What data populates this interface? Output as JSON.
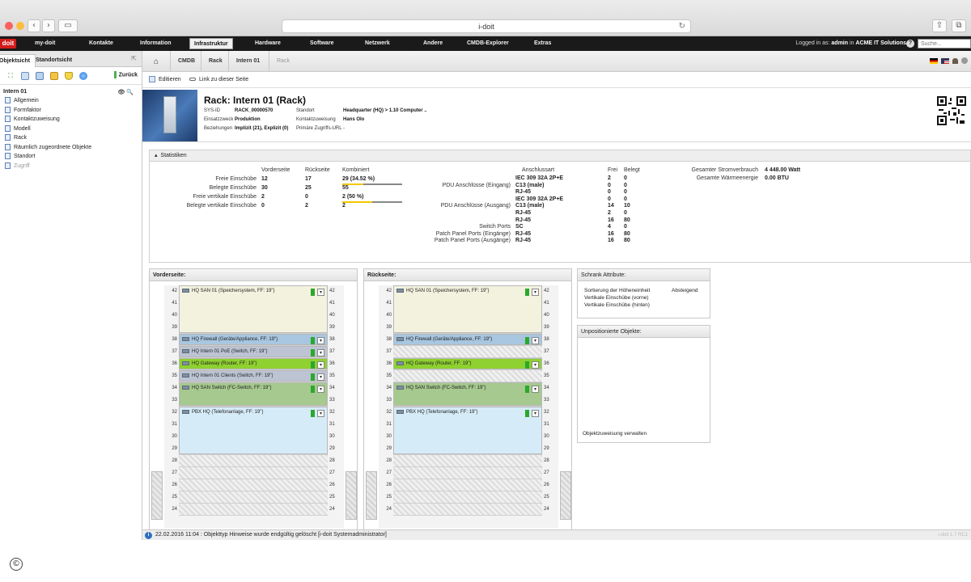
{
  "browser": {
    "url_title": "i-doit",
    "back_glyph": "‹",
    "forward_glyph": "›",
    "sidebar_glyph": "▭",
    "reload_glyph": "↻",
    "share_glyph": "⇧",
    "tabs_glyph": "⧉",
    "traffic": [
      "#fc605c",
      "#fdbc40",
      "#34c84a"
    ]
  },
  "topnav": {
    "logo": "doit",
    "items": [
      "my-doit",
      "Kontakte",
      "Information",
      "Infrastruktur",
      "Hardware",
      "Software",
      "Netzwerk",
      "Andere",
      "CMDB-Explorer",
      "Extras"
    ],
    "active_index": 3,
    "logged_in_prefix": "Logged in as:",
    "user": "admin",
    "in": "in",
    "company": "ACME IT Solutions",
    "help": "?",
    "search_placeholder": "Suche..."
  },
  "leftpanel": {
    "tab_object": "Objektsicht",
    "tab_location": "Standortsicht",
    "collapse": "⇱",
    "back_label": "Zurück",
    "root": "Intern 01",
    "root_icons": "👁 🔍",
    "items": [
      {
        "label": "Allgemein",
        "dim": false
      },
      {
        "label": "Formfaktor",
        "dim": false
      },
      {
        "label": "Kontaktzuweisung",
        "dim": false
      },
      {
        "label": "Modell",
        "dim": false
      },
      {
        "label": "Rack",
        "dim": false
      },
      {
        "label": "Räumlich zugeordnete Objekte",
        "dim": false
      },
      {
        "label": "Standort",
        "dim": false
      },
      {
        "label": "Zugriff",
        "dim": true
      }
    ]
  },
  "breadcrumb": {
    "home": "⌂",
    "items": [
      "CMDB",
      "Rack",
      "Intern 01",
      "Rack"
    ]
  },
  "actions": {
    "edit": "Editieren",
    "link": "Link zu dieser Seite"
  },
  "object": {
    "title": "Rack: Intern 01 (Rack)",
    "sysid_label": "SYS-ID",
    "sysid": "RACK_00000570",
    "purpose_label": "Einsatzzweck",
    "purpose": "Produktion",
    "relations_label": "Beziehungen",
    "relations": "Implizit (21), Explizit (0)",
    "location_label": "Standort",
    "location": "Headquarter (HQ) > 1.10 Computer ..",
    "contact_label": "Kontaktzuweisung",
    "contact": "Hans Olo",
    "url_label": "Primäre Zugriffs-URL",
    "url": "-"
  },
  "stats": {
    "header": "Statistiken",
    "col_front": "Vorderseite",
    "col_back": "Rückseite",
    "col_combined": "Kombiniert",
    "rows": [
      {
        "label": "Freie Einschübe",
        "front": "12",
        "back": "17",
        "combined": "29 (34.52 %)",
        "bar": 0.3452
      },
      {
        "label": "Belegte Einschübe",
        "front": "30",
        "back": "25",
        "combined": "55"
      },
      {
        "label": "Freie vertikale Einschübe",
        "front": "2",
        "back": "0",
        "combined": "2 (50 %)",
        "bar": 0.5
      },
      {
        "label": "Belegte vertikale Einschübe",
        "front": "0",
        "back": "2",
        "combined": "2"
      }
    ],
    "conn_header": "Anschlussart",
    "free_header": "Frei",
    "used_header": "Belegt",
    "ports": [
      {
        "label": "",
        "type": "IEC 309 32A 2P+E",
        "free": "2",
        "used": "0"
      },
      {
        "label": "PDU Anschlüsse (Eingang)",
        "type": "C13 (male)",
        "free": "0",
        "used": "0"
      },
      {
        "label": "",
        "type": "RJ-45",
        "free": "0",
        "used": "0"
      },
      {
        "label": "",
        "type": "IEC 309 32A 2P+E",
        "free": "0",
        "used": "0"
      },
      {
        "label": "PDU Anschlüsse (Ausgang)",
        "type": "C13 (male)",
        "free": "14",
        "used": "10"
      },
      {
        "label": "",
        "type": "RJ-45",
        "free": "2",
        "used": "0"
      },
      {
        "label": "",
        "type": "RJ-45",
        "free": "16",
        "used": "80"
      },
      {
        "label": "Switch Ports",
        "type": "SC",
        "free": "4",
        "used": "0"
      },
      {
        "label": "Patch Panel Ports (Eingänge)",
        "type": "RJ-45",
        "free": "16",
        "used": "80"
      },
      {
        "label": "Patch Panel Ports (Ausgänge)",
        "type": "RJ-45",
        "free": "16",
        "used": "80"
      }
    ],
    "power_label": "Gesamter Stromverbrauch",
    "power_value": "4 448.00 Watt",
    "heat_label": "Gesamte Wärmeenergie",
    "heat_value": "0.00 BTU"
  },
  "front": {
    "header": "Vorderseite:",
    "rows": [
      "42",
      "41",
      "40",
      "39",
      "38",
      "37",
      "36",
      "35",
      "34",
      "33",
      "32",
      "31",
      "30",
      "29",
      "28",
      "27",
      "26",
      "25",
      "24"
    ],
    "devices": [
      {
        "label": "HQ SAN 01 (Speichersystem, FF: 19\")",
        "start": 42,
        "units": 4,
        "color": "#f3f2df"
      },
      {
        "label": "HQ Firewall (Geräte/Appliance, FF: 19\")",
        "start": 38,
        "units": 1,
        "color": "#a8c6e0"
      },
      {
        "label": "HQ Intern 01 PoE (Switch, FF: 19\")",
        "start": 37,
        "units": 1,
        "color": "#bcc4d4"
      },
      {
        "label": "HQ Gateway (Router, FF: 19\")",
        "start": 36,
        "units": 1,
        "color": "#8fd130"
      },
      {
        "label": "HQ Intern 01 Clients (Switch, FF: 19\")",
        "start": 35,
        "units": 1,
        "color": "#bcc4d4"
      },
      {
        "label": "HQ SAN Switch (FC-Switch, FF: 19\")",
        "start": 34,
        "units": 2,
        "color": "#a5c98e"
      },
      {
        "label": "PBX HQ (Telefonanlage, FF: 19\")",
        "start": 32,
        "units": 4,
        "color": "#d6ebf8"
      }
    ]
  },
  "back": {
    "header": "Rückseite:",
    "rows": [
      "42",
      "41",
      "40",
      "39",
      "38",
      "37",
      "36",
      "35",
      "34",
      "33",
      "32",
      "31",
      "30",
      "29",
      "28",
      "27",
      "26",
      "25",
      "24"
    ],
    "devices": [
      {
        "label": "HQ SAN 01 (Speichersystem, FF: 19\")",
        "start": 42,
        "units": 4,
        "color": "#f3f2df"
      },
      {
        "label": "HQ Firewall (Geräte/Appliance, FF: 19\")",
        "start": 38,
        "units": 1,
        "color": "#a8c6e0"
      },
      {
        "label": "HQ Gateway (Router, FF: 19\")",
        "start": 36,
        "units": 1,
        "color": "#8fd130"
      },
      {
        "label": "HQ SAN Switch (FC-Switch, FF: 19\")",
        "start": 34,
        "units": 2,
        "color": "#a5c98e"
      },
      {
        "label": "PBX HQ (Telefonanlage, FF: 19\")",
        "start": 32,
        "units": 4,
        "color": "#d6ebf8"
      }
    ]
  },
  "attributes": {
    "header": "Schrank Attribute:",
    "sort_label": "Sortierung der Höheneinheit",
    "sort_value": "Absteigend",
    "vert_front": "Vertikale Einschübe (vorne)",
    "vert_back": "Vertikale Einschübe (hinten)"
  },
  "unpositioned": {
    "header": "Unpositionierte Objekte:",
    "manage": "Objektzuweisung verwalten"
  },
  "statusbar": {
    "info": "i",
    "message": "22.02.2016 11:04 : Objekttyp Hinweise wurde endgültig gelöscht [i-doit Systemadministrator]",
    "version": "i-doit 1.7 RC1"
  },
  "footer": {
    "copyright": "©"
  }
}
